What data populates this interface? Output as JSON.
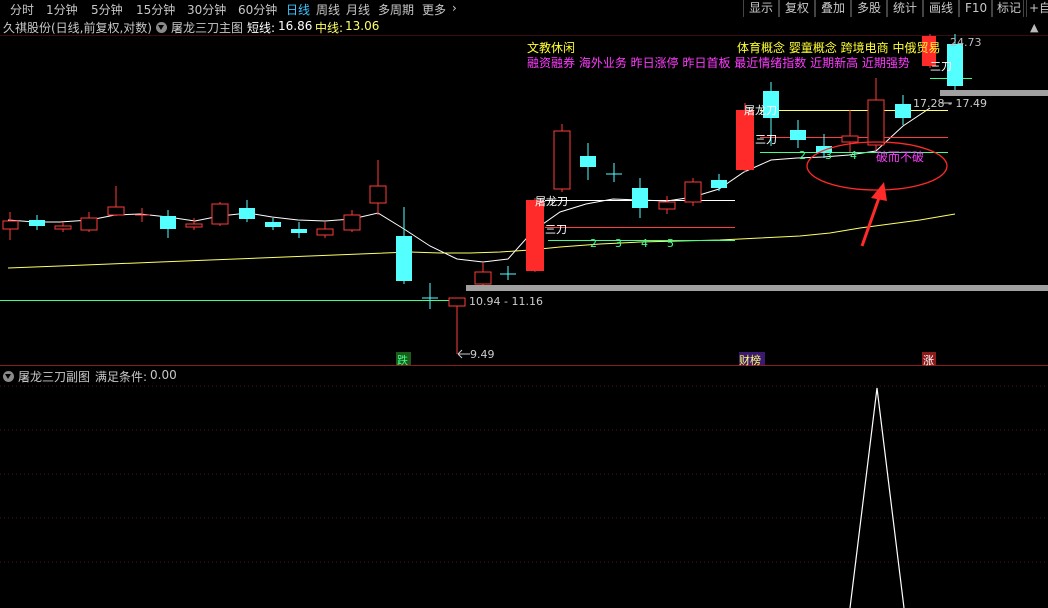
{
  "toolbar": {
    "periods": [
      "分时",
      "1分钟",
      "5分钟",
      "15分钟",
      "30分钟",
      "60分钟",
      "日线",
      "周线",
      "月线",
      "多周期",
      "更多"
    ],
    "active_period": "日线",
    "right_buttons": [
      "显示",
      "复权",
      "叠加",
      "多股",
      "统计",
      "画线",
      "F10",
      "标记",
      "+自"
    ]
  },
  "main_panel": {
    "stock_info": "久祺股份(日线,前复权,对数)",
    "indicator_name": "屠龙三刀主图",
    "short_label": "短线:",
    "short_value": "16.86",
    "mid_label": "中线:",
    "mid_value": "13.06",
    "concepts": {
      "line1_yellow": "文教休闲",
      "line1_right": "体育概念 婴童概念 跨境电商 中俄贸易",
      "line2_magenta": "融资融券 海外业务 昨日涨停 昨日首板 最近情绪指数 近期新高 近期强势",
      "price_top": "24.73"
    },
    "annotations": {
      "range_low": "10.94 - 11.16",
      "range_high": "17.28 - 17.49",
      "low_price": "9.49",
      "tulong_1": "屠龙",
      "dao_1": "刀",
      "sandao_1": "三刀",
      "tulong_2": "屠龙",
      "dao_2": "刀",
      "sandao_2": "三刀",
      "sandao_3": "三刀",
      "counts_1": [
        "2",
        "3",
        "4",
        "5"
      ],
      "counts_2": [
        "2",
        "3",
        "4"
      ],
      "circle_text": "破而不破",
      "tag_die": "跌",
      "tag_caibang": "财榜",
      "tag_zhang": "涨"
    }
  },
  "sub_panel": {
    "title": "屠龙三刀副图",
    "condition_label": "满足条件:",
    "condition_value": "0.00"
  },
  "colors": {
    "up": "#ff3c3c",
    "down": "#54ffff",
    "ma_short": "#ffffff",
    "ma_mid": "#ffff66",
    "accent_blue": "#3fc6ff",
    "magenta": "#ff3cff",
    "yellow_text": "#ffff33",
    "green": "#55dd55"
  }
}
